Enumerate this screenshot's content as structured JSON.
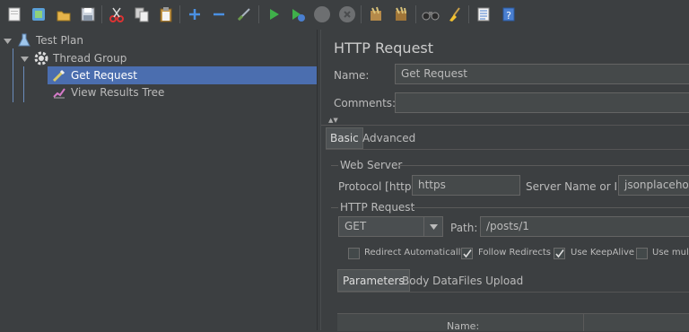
{
  "tree": {
    "items": [
      {
        "label": "Test Plan"
      },
      {
        "label": "Thread Group"
      },
      {
        "label": "Get Request"
      },
      {
        "label": "View Results Tree"
      }
    ]
  },
  "panel": {
    "title": "HTTP Request",
    "name_label": "Name:",
    "name_value": "Get Request",
    "comments_label": "Comments:",
    "comments_value": "",
    "collapse_arrows": "▲▼",
    "tabs": [
      "Basic",
      "Advanced"
    ],
    "web_server": {
      "section_label": "Web Server",
      "protocol_label": "Protocol [http]:",
      "protocol_value": "https",
      "server_label": "Server Name or IP:",
      "server_value": "jsonplaceholde"
    },
    "http_request": {
      "section_label": "HTTP Request",
      "method_value": "GET",
      "path_label": "Path:",
      "path_value": "/posts/1"
    },
    "checkboxes": [
      {
        "label": "Redirect Automatically",
        "checked": false
      },
      {
        "label": "Follow Redirects",
        "checked": true
      },
      {
        "label": "Use KeepAlive",
        "checked": true
      },
      {
        "label": "Use multi",
        "checked": false
      }
    ],
    "sub_tabs": [
      "Parameters",
      "Body Data",
      "Files Upload"
    ],
    "table_header": "Name:"
  },
  "colors": {
    "background": "#3c3f41",
    "selection": "#4b6eaf",
    "run_green": "#3fb04a",
    "arrow_red": "#e0322c"
  }
}
